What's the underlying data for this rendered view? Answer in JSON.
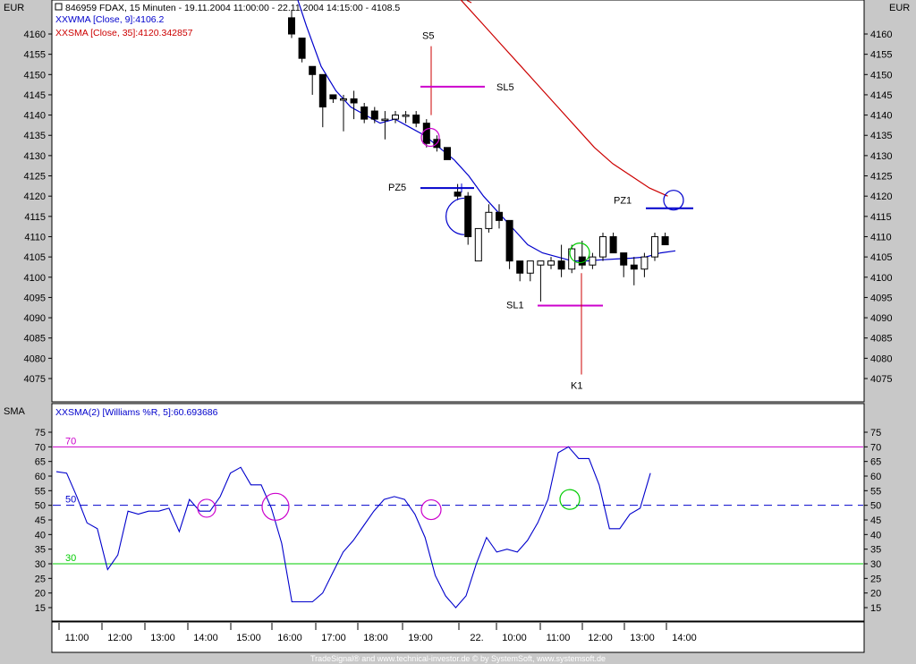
{
  "header": {
    "title": "846959  FDAX, 15 Minuten - 19.11.2004 11:00:00 - 22.11.2004 14:15:00 - 4108.5",
    "legend_wma": "WMA [Close, 9]:4106.2",
    "legend_sma": "SMA [Close, 35]:4120.342857",
    "legend_prefix": "XX",
    "currency_left": "EUR",
    "currency_right": "EUR"
  },
  "lower_panel": {
    "label": "SMA",
    "legend": "SMA(2) [Williams %R, 5]:60.693686",
    "legend_prefix": "XX"
  },
  "footer": {
    "credits": "TradeSignal® and www.technical-investor.de © by SystemSoft, www.systemsoft.de"
  },
  "colors": {
    "background": "#c8c8c8",
    "plot_bg": "#ffffff",
    "wma": "#0000cc",
    "sma": "#cc0000",
    "magenta": "#cc00cc",
    "green": "#00cc00",
    "blue": "#0000cc"
  },
  "chart_data": [
    {
      "type": "candlestick",
      "title": "846959  FDAX, 15 Minuten",
      "y_ticks": [
        4160,
        4155,
        4150,
        4145,
        4140,
        4135,
        4130,
        4125,
        4120,
        4115,
        4110,
        4105,
        4100,
        4095,
        4090,
        4085,
        4080,
        4075
      ],
      "ylim": [
        4072,
        4163
      ],
      "candles": [
        {
          "o": 4164,
          "h": 4166,
          "l": 4159,
          "c": 4160
        },
        {
          "o": 4159,
          "h": 4159,
          "l": 4153,
          "c": 4154
        },
        {
          "o": 4152,
          "h": 4152,
          "l": 4145,
          "c": 4150
        },
        {
          "o": 4150,
          "h": 4150,
          "l": 4137,
          "c": 4142
        },
        {
          "o": 4145,
          "h": 4145,
          "l": 4143,
          "c": 4144
        },
        {
          "o": 4144,
          "h": 4145,
          "l": 4136,
          "c": 4144
        },
        {
          "o": 4144,
          "h": 4146,
          "l": 4139,
          "c": 4143
        },
        {
          "o": 4142,
          "h": 4143,
          "l": 4138,
          "c": 4139
        },
        {
          "o": 4141,
          "h": 4142,
          "l": 4138,
          "c": 4139
        },
        {
          "o": 4139,
          "h": 4141,
          "l": 4134,
          "c": 4139
        },
        {
          "o": 4139,
          "h": 4141,
          "l": 4138,
          "c": 4140
        },
        {
          "o": 4140,
          "h": 4141,
          "l": 4138,
          "c": 4140
        },
        {
          "o": 4140,
          "h": 4141,
          "l": 4137,
          "c": 4138
        },
        {
          "o": 4138,
          "h": 4139,
          "l": 4132,
          "c": 4133
        },
        {
          "o": 4134,
          "h": 4135,
          "l": 4131,
          "c": 4132
        },
        {
          "o": 4132,
          "h": 4132,
          "l": 4129,
          "c": 4129
        },
        {
          "o": 4121,
          "h": 4123,
          "l": 4119,
          "c": 4120
        },
        {
          "o": 4120,
          "h": 4121,
          "l": 4108,
          "c": 4110
        },
        {
          "o": 4104,
          "h": 4112,
          "l": 4106,
          "c": 4112
        },
        {
          "o": 4112,
          "h": 4118,
          "l": 4111,
          "c": 4116
        },
        {
          "o": 4116,
          "h": 4118,
          "l": 4112,
          "c": 4114
        },
        {
          "o": 4114,
          "h": 4114,
          "l": 4102,
          "c": 4104
        },
        {
          "o": 4104,
          "h": 4104,
          "l": 4099,
          "c": 4101
        },
        {
          "o": 4101,
          "h": 4104,
          "l": 4099,
          "c": 4104
        },
        {
          "o": 4103,
          "h": 4104,
          "l": 4094,
          "c": 4104
        },
        {
          "o": 4103,
          "h": 4105,
          "l": 4102,
          "c": 4104
        },
        {
          "o": 4104,
          "h": 4108,
          "l": 4100,
          "c": 4102
        },
        {
          "o": 4102,
          "h": 4108,
          "l": 4101,
          "c": 4107
        },
        {
          "o": 4105,
          "h": 4109,
          "l": 4102,
          "c": 4103
        },
        {
          "o": 4103,
          "h": 4106,
          "l": 4102,
          "c": 4105
        },
        {
          "o": 4105,
          "h": 4111,
          "l": 4104,
          "c": 4110
        },
        {
          "o": 4110,
          "h": 4111,
          "l": 4106,
          "c": 4106
        },
        {
          "o": 4106,
          "h": 4106,
          "l": 4100,
          "c": 4103
        },
        {
          "o": 4103,
          "h": 4105,
          "l": 4098,
          "c": 4102
        },
        {
          "o": 4102,
          "h": 4106,
          "l": 4100,
          "c": 4105
        },
        {
          "o": 4105,
          "h": 4111,
          "l": 4104,
          "c": 4110
        },
        {
          "o": 4110,
          "h": 4111,
          "l": 4108,
          "c": 4108
        }
      ],
      "series": [
        {
          "name": "WMA [Close, 9]",
          "type": "line",
          "values": [
            4173,
            4162,
            4152,
            4146,
            4142,
            4140,
            4138,
            4139,
            4137,
            4135,
            4132,
            4129,
            4125,
            4120,
            4116,
            4112,
            4108,
            4106,
            4105,
            4104,
            4104,
            4104.3,
            4104.5,
            4104.7,
            4105,
            4106,
            4106.5
          ]
        },
        {
          "name": "SMA [Close, 35]",
          "type": "line",
          "values": [
            4177,
            4172,
            4167,
            4162,
            4157,
            4152,
            4147,
            4142,
            4137,
            4132,
            4128,
            4125,
            4122,
            4120
          ]
        }
      ],
      "annotations": [
        {
          "label": "S5",
          "price_top": 4157,
          "price_bottom": 4140
        },
        {
          "label": "SL5",
          "price": 4147
        },
        {
          "label": "PZ5",
          "price": 4122
        },
        {
          "label": "PZ1",
          "price": 4117
        },
        {
          "label": "SL1",
          "price": 4093
        },
        {
          "label": "K1",
          "price_top": 4101,
          "price_bottom": 4076
        }
      ]
    },
    {
      "type": "line",
      "title": "SMA(2) [Williams %R, 5]",
      "y_ticks": [
        75,
        70,
        65,
        60,
        55,
        50,
        45,
        40,
        35,
        30,
        25,
        20,
        15
      ],
      "ylim": [
        12,
        77
      ],
      "x_tick_labels": [
        "11:00",
        "12:00",
        "13:00",
        "14:00",
        "15:00",
        "16:00",
        "17:00",
        "18:00",
        "19:00",
        "22.",
        "10:00",
        "11:00",
        "12:00",
        "13:00",
        "14:00"
      ],
      "reference_lines": [
        {
          "label": "70",
          "value": 70,
          "color": "#cc00cc"
        },
        {
          "label": "50",
          "value": 50,
          "color": "#0000cc",
          "dashed": true
        },
        {
          "label": "30",
          "value": 30,
          "color": "#00cc00"
        }
      ],
      "series": [
        {
          "name": "SMA(2) [Williams %R, 5]",
          "values": [
            61.5,
            61,
            53,
            44,
            42,
            28,
            33,
            48,
            47,
            48,
            48,
            49,
            41,
            52,
            48,
            48,
            53,
            61,
            63,
            57,
            57,
            49,
            37,
            17,
            17,
            17,
            20,
            27,
            34,
            38,
            43,
            48,
            52,
            53,
            52,
            47,
            39,
            26,
            19,
            15,
            19,
            30,
            39,
            34,
            35,
            34,
            38,
            44,
            52,
            68,
            70,
            66,
            66,
            57,
            42,
            42,
            47,
            49,
            61
          ]
        }
      ]
    }
  ]
}
